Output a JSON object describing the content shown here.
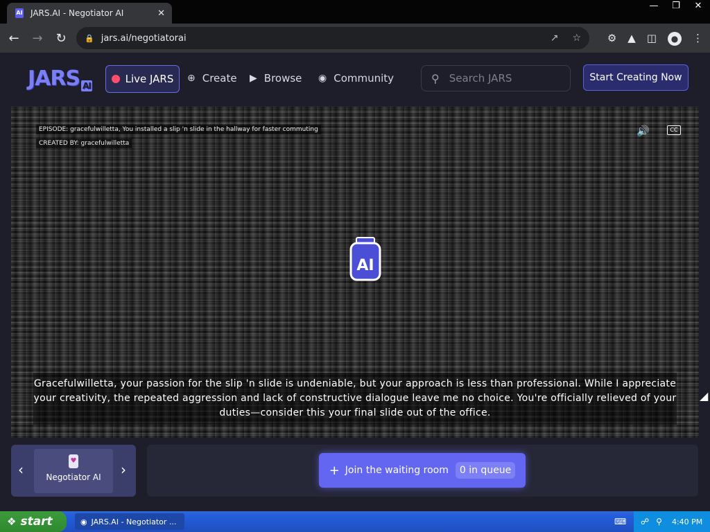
{
  "browser": {
    "tab_title": "JARS.AI - Negotiator AI",
    "tab_close": "✕",
    "url": "jars.ai/negotiatorai",
    "window_controls": [
      "—",
      "❐",
      "✕"
    ]
  },
  "site": {
    "logo": "JARS",
    "logo_badge": "AI",
    "nav": {
      "live": "Live JARS",
      "create": "Create",
      "browse": "Browse",
      "community": "Community"
    },
    "search_placeholder": "Search JARS",
    "cta": "Start Creating Now"
  },
  "player": {
    "episode": "EPISODE: gracefulwilletta, You installed a slip 'n slide in the hallway for faster commuting",
    "created_by": "CREATED BY: gracefulwilletta",
    "jar_label": "AI",
    "caption": "Gracefulwilletta, your passion for the slip 'n slide is undeniable, but your approach is less than professional. While I appreciate your creativity, the repeated aggression and lack of constructive dialogue leave me no choice. You're officially relieved of your duties—consider this your final slide out of the office."
  },
  "agent_selector": {
    "name": "Negotiator AI",
    "prev": "‹",
    "next": "›"
  },
  "queue": {
    "join_label": "Join the waiting room",
    "count_label": "0 in queue"
  },
  "taskbar": {
    "start": "start",
    "task_label": "JARS.AI - Negotiator ...",
    "time": "4:40 PM"
  },
  "colors": {
    "accent": "#6366f1",
    "live_dot": "#ff4d6a",
    "page_bg": "#1d1e2a"
  }
}
